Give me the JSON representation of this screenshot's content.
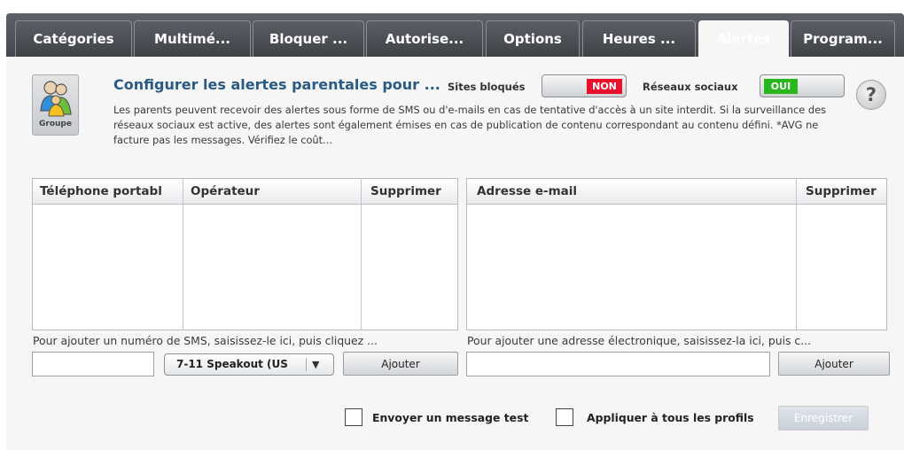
{
  "tabs": [
    {
      "label": "Catégories",
      "active": false
    },
    {
      "label": "Multimé...",
      "active": false
    },
    {
      "label": "Bloquer ...",
      "active": false
    },
    {
      "label": "Autorise...",
      "active": false
    },
    {
      "label": "Options",
      "active": false
    },
    {
      "label": "Heures ...",
      "active": false
    },
    {
      "label": "Alertes",
      "active": true
    },
    {
      "label": "Program...",
      "active": false
    }
  ],
  "group_button": {
    "label": "Groupe",
    "icon": "group-users-icon"
  },
  "header": {
    "title": "Configurer les alertes parentales pour ...",
    "description": "Les parents peuvent recevoir des alertes sous forme de SMS ou d'e-mails en cas de tentative d'accès à un site interdit. Si la surveillance des réseaux sociaux est active, des alertes sont également émises en cas de publication de contenu correspondant au contenu défini. *AVG ne facture pas les messages. Vérifiez le coût..."
  },
  "toggles": {
    "blocked_sites": {
      "label": "Sites bloqués",
      "state": "NON",
      "color": "#e8102a"
    },
    "social_networks": {
      "label": "Réseaux sociaux",
      "state": "OUI",
      "color": "#28b81e"
    }
  },
  "help": {
    "glyph": "?"
  },
  "sms_table": {
    "columns": [
      "Téléphone portabl",
      "Opérateur",
      "Supprimer"
    ],
    "rows": [],
    "hint": "Pour ajouter un numéro de SMS, saisissez-le ici, puis cliquez ...",
    "input_value": "",
    "carrier_selected": "7-11 Speakout (US",
    "add_label": "Ajouter"
  },
  "email_table": {
    "columns": [
      "Adresse e-mail",
      "Supprimer"
    ],
    "rows": [],
    "hint": "Pour ajouter une adresse électronique, saisissez-la ici, puis c...",
    "input_value": "",
    "add_label": "Ajouter"
  },
  "footer": {
    "send_test_label": "Envoyer un message test",
    "send_test_checked": false,
    "apply_all_label": "Appliquer à tous les profils",
    "apply_all_checked": false,
    "save_label": "Enregistrer",
    "save_enabled": false
  },
  "colors": {
    "accent": "#2a5a86",
    "tabbar": "#4f5358"
  }
}
